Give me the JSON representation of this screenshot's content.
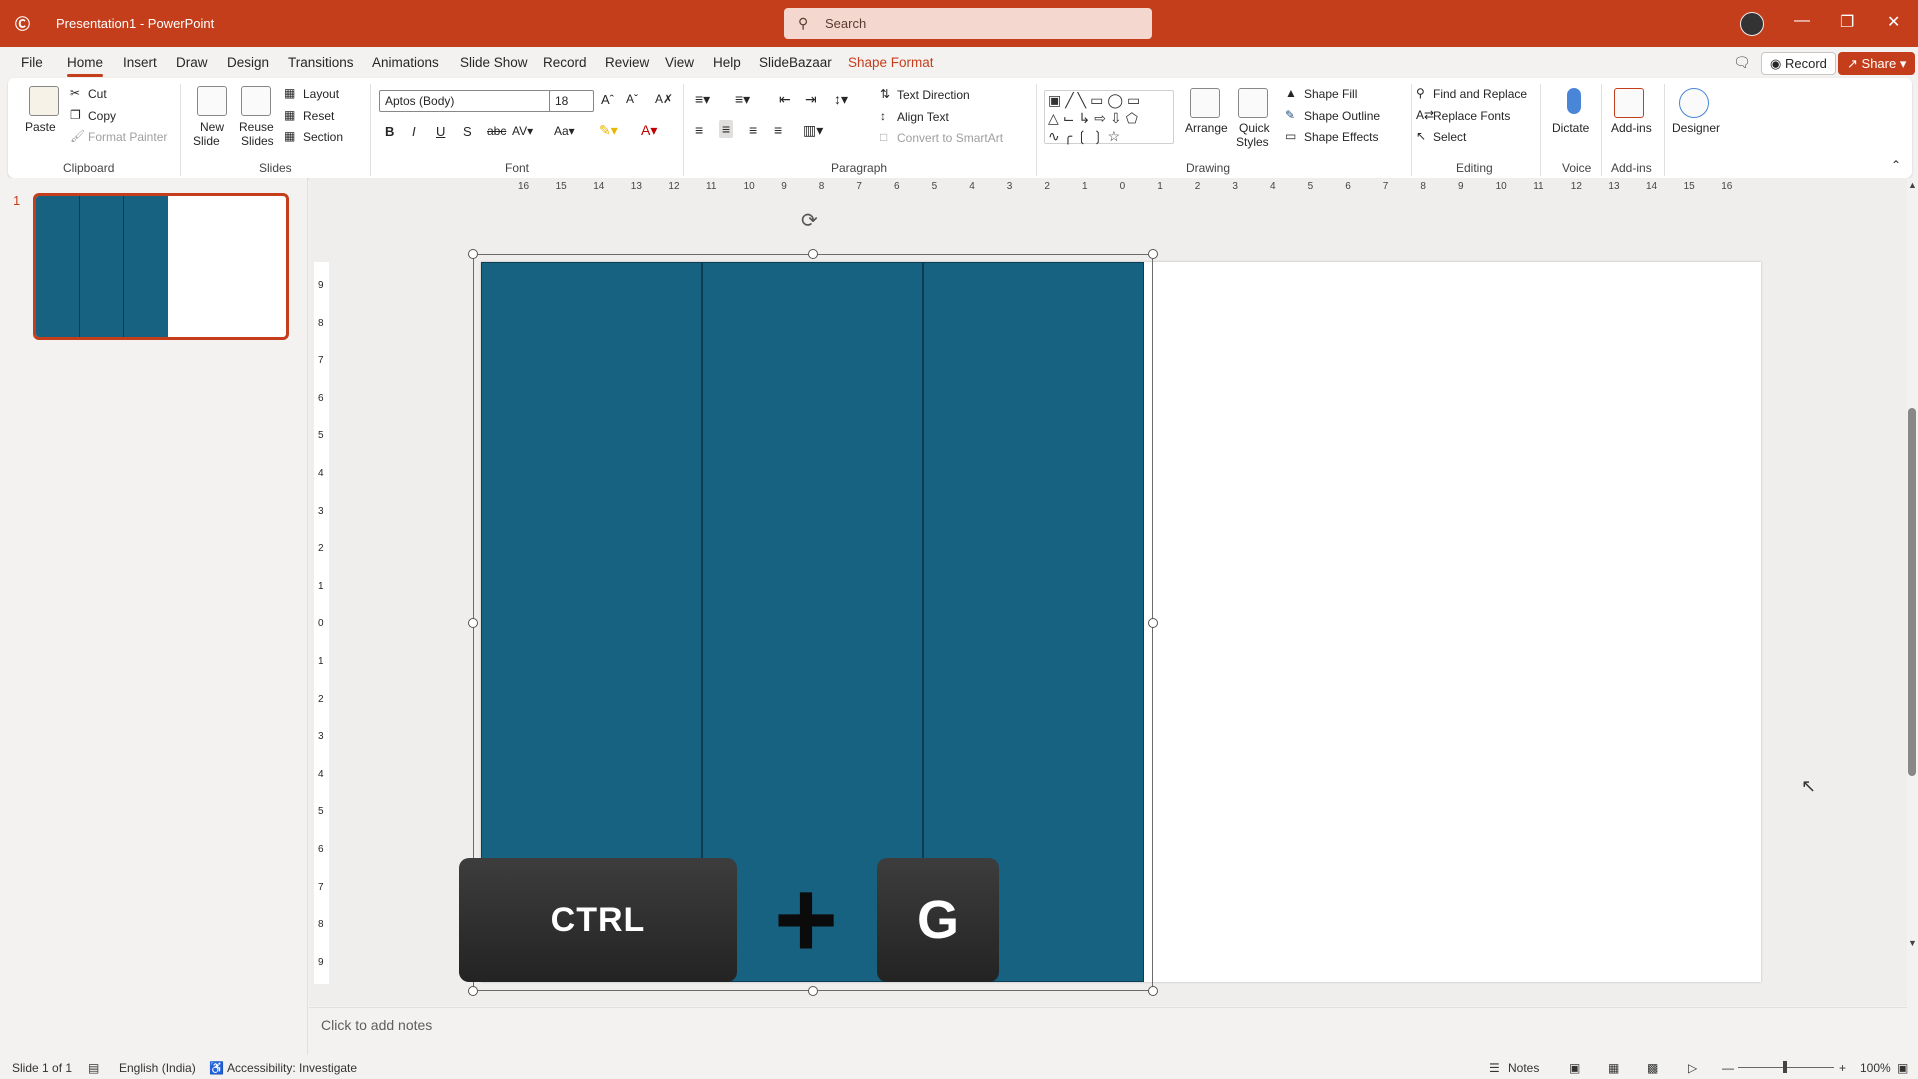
{
  "titlebar": {
    "doc_title": "Presentation1 - PowerPoint",
    "search_placeholder": "Search"
  },
  "menu": {
    "tabs": [
      "File",
      "Home",
      "Insert",
      "Draw",
      "Design",
      "Transitions",
      "Animations",
      "Slide Show",
      "Record",
      "Review",
      "View",
      "Help",
      "SlideBazaar",
      "Shape Format"
    ],
    "record_button": "Record",
    "share_button": "Share"
  },
  "ribbon": {
    "clipboard": {
      "paste": "Paste",
      "cut": "Cut",
      "copy": "Copy",
      "format_painter": "Format Painter",
      "group": "Clipboard"
    },
    "slides": {
      "new_slide_1": "New",
      "new_slide_2": "Slide",
      "reuse_1": "Reuse",
      "reuse_2": "Slides",
      "layout": "Layout",
      "reset": "Reset",
      "section": "Section",
      "group": "Slides"
    },
    "font": {
      "font_name": "Aptos (Body)",
      "font_size": "18",
      "group": "Font"
    },
    "paragraph": {
      "text_direction": "Text Direction",
      "align_text": "Align Text",
      "convert_smartart": "Convert to SmartArt",
      "group": "Paragraph"
    },
    "drawing": {
      "arrange": "Arrange",
      "quick_1": "Quick",
      "quick_2": "Styles",
      "shape_fill": "Shape Fill",
      "shape_outline": "Shape Outline",
      "shape_effects": "Shape Effects",
      "group": "Drawing"
    },
    "editing": {
      "find_replace": "Find and Replace",
      "replace_fonts": "Replace Fonts",
      "select": "Select",
      "group": "Editing"
    },
    "voice": {
      "dictate": "Dictate",
      "group": "Voice"
    },
    "addins": {
      "addins": "Add-ins",
      "group": "Add-ins"
    },
    "designer": {
      "designer": "Designer"
    }
  },
  "hruler_ticks": [
    "16",
    "15",
    "14",
    "13",
    "12",
    "11",
    "10",
    "9",
    "8",
    "7",
    "6",
    "5",
    "4",
    "3",
    "2",
    "1",
    "0",
    "1",
    "2",
    "3",
    "4",
    "5",
    "6",
    "7",
    "8",
    "9",
    "10",
    "11",
    "12",
    "13",
    "14",
    "15",
    "16"
  ],
  "vruler_ticks": [
    "9",
    "8",
    "7",
    "6",
    "5",
    "4",
    "3",
    "2",
    "1",
    "0",
    "1",
    "2",
    "3",
    "4",
    "5",
    "6",
    "7",
    "8",
    "9"
  ],
  "thumbnail": {
    "number": "1"
  },
  "slide": {
    "ctrl_key": "CTRL",
    "plus": "+",
    "g_key": "G"
  },
  "notes": {
    "placeholder": "Click to add notes"
  },
  "status": {
    "slide_counter": "Slide 1 of 1",
    "language": "English (India)",
    "accessibility": "Accessibility: Investigate",
    "notes_button": "Notes",
    "zoom": "100%"
  },
  "colors": {
    "brand": "#c43e1c",
    "shape_fill": "#176181"
  }
}
